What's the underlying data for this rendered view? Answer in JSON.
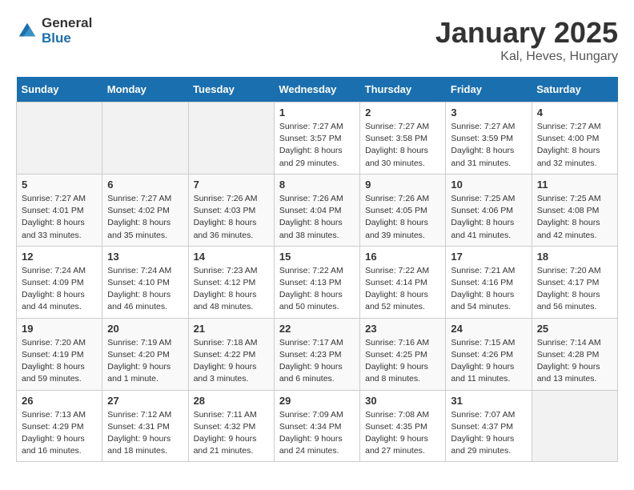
{
  "logo": {
    "text_general": "General",
    "text_blue": "Blue"
  },
  "title": "January 2025",
  "subtitle": "Kal, Heves, Hungary",
  "weekdays": [
    "Sunday",
    "Monday",
    "Tuesday",
    "Wednesday",
    "Thursday",
    "Friday",
    "Saturday"
  ],
  "weeks": [
    [
      {
        "day": "",
        "sunrise": "",
        "sunset": "",
        "daylight": "",
        "empty": true
      },
      {
        "day": "",
        "sunrise": "",
        "sunset": "",
        "daylight": "",
        "empty": true
      },
      {
        "day": "",
        "sunrise": "",
        "sunset": "",
        "daylight": "",
        "empty": true
      },
      {
        "day": "1",
        "sunrise": "Sunrise: 7:27 AM",
        "sunset": "Sunset: 3:57 PM",
        "daylight": "Daylight: 8 hours and 29 minutes."
      },
      {
        "day": "2",
        "sunrise": "Sunrise: 7:27 AM",
        "sunset": "Sunset: 3:58 PM",
        "daylight": "Daylight: 8 hours and 30 minutes."
      },
      {
        "day": "3",
        "sunrise": "Sunrise: 7:27 AM",
        "sunset": "Sunset: 3:59 PM",
        "daylight": "Daylight: 8 hours and 31 minutes."
      },
      {
        "day": "4",
        "sunrise": "Sunrise: 7:27 AM",
        "sunset": "Sunset: 4:00 PM",
        "daylight": "Daylight: 8 hours and 32 minutes."
      }
    ],
    [
      {
        "day": "5",
        "sunrise": "Sunrise: 7:27 AM",
        "sunset": "Sunset: 4:01 PM",
        "daylight": "Daylight: 8 hours and 33 minutes."
      },
      {
        "day": "6",
        "sunrise": "Sunrise: 7:27 AM",
        "sunset": "Sunset: 4:02 PM",
        "daylight": "Daylight: 8 hours and 35 minutes."
      },
      {
        "day": "7",
        "sunrise": "Sunrise: 7:26 AM",
        "sunset": "Sunset: 4:03 PM",
        "daylight": "Daylight: 8 hours and 36 minutes."
      },
      {
        "day": "8",
        "sunrise": "Sunrise: 7:26 AM",
        "sunset": "Sunset: 4:04 PM",
        "daylight": "Daylight: 8 hours and 38 minutes."
      },
      {
        "day": "9",
        "sunrise": "Sunrise: 7:26 AM",
        "sunset": "Sunset: 4:05 PM",
        "daylight": "Daylight: 8 hours and 39 minutes."
      },
      {
        "day": "10",
        "sunrise": "Sunrise: 7:25 AM",
        "sunset": "Sunset: 4:06 PM",
        "daylight": "Daylight: 8 hours and 41 minutes."
      },
      {
        "day": "11",
        "sunrise": "Sunrise: 7:25 AM",
        "sunset": "Sunset: 4:08 PM",
        "daylight": "Daylight: 8 hours and 42 minutes."
      }
    ],
    [
      {
        "day": "12",
        "sunrise": "Sunrise: 7:24 AM",
        "sunset": "Sunset: 4:09 PM",
        "daylight": "Daylight: 8 hours and 44 minutes."
      },
      {
        "day": "13",
        "sunrise": "Sunrise: 7:24 AM",
        "sunset": "Sunset: 4:10 PM",
        "daylight": "Daylight: 8 hours and 46 minutes."
      },
      {
        "day": "14",
        "sunrise": "Sunrise: 7:23 AM",
        "sunset": "Sunset: 4:12 PM",
        "daylight": "Daylight: 8 hours and 48 minutes."
      },
      {
        "day": "15",
        "sunrise": "Sunrise: 7:22 AM",
        "sunset": "Sunset: 4:13 PM",
        "daylight": "Daylight: 8 hours and 50 minutes."
      },
      {
        "day": "16",
        "sunrise": "Sunrise: 7:22 AM",
        "sunset": "Sunset: 4:14 PM",
        "daylight": "Daylight: 8 hours and 52 minutes."
      },
      {
        "day": "17",
        "sunrise": "Sunrise: 7:21 AM",
        "sunset": "Sunset: 4:16 PM",
        "daylight": "Daylight: 8 hours and 54 minutes."
      },
      {
        "day": "18",
        "sunrise": "Sunrise: 7:20 AM",
        "sunset": "Sunset: 4:17 PM",
        "daylight": "Daylight: 8 hours and 56 minutes."
      }
    ],
    [
      {
        "day": "19",
        "sunrise": "Sunrise: 7:20 AM",
        "sunset": "Sunset: 4:19 PM",
        "daylight": "Daylight: 8 hours and 59 minutes."
      },
      {
        "day": "20",
        "sunrise": "Sunrise: 7:19 AM",
        "sunset": "Sunset: 4:20 PM",
        "daylight": "Daylight: 9 hours and 1 minute."
      },
      {
        "day": "21",
        "sunrise": "Sunrise: 7:18 AM",
        "sunset": "Sunset: 4:22 PM",
        "daylight": "Daylight: 9 hours and 3 minutes."
      },
      {
        "day": "22",
        "sunrise": "Sunrise: 7:17 AM",
        "sunset": "Sunset: 4:23 PM",
        "daylight": "Daylight: 9 hours and 6 minutes."
      },
      {
        "day": "23",
        "sunrise": "Sunrise: 7:16 AM",
        "sunset": "Sunset: 4:25 PM",
        "daylight": "Daylight: 9 hours and 8 minutes."
      },
      {
        "day": "24",
        "sunrise": "Sunrise: 7:15 AM",
        "sunset": "Sunset: 4:26 PM",
        "daylight": "Daylight: 9 hours and 11 minutes."
      },
      {
        "day": "25",
        "sunrise": "Sunrise: 7:14 AM",
        "sunset": "Sunset: 4:28 PM",
        "daylight": "Daylight: 9 hours and 13 minutes."
      }
    ],
    [
      {
        "day": "26",
        "sunrise": "Sunrise: 7:13 AM",
        "sunset": "Sunset: 4:29 PM",
        "daylight": "Daylight: 9 hours and 16 minutes."
      },
      {
        "day": "27",
        "sunrise": "Sunrise: 7:12 AM",
        "sunset": "Sunset: 4:31 PM",
        "daylight": "Daylight: 9 hours and 18 minutes."
      },
      {
        "day": "28",
        "sunrise": "Sunrise: 7:11 AM",
        "sunset": "Sunset: 4:32 PM",
        "daylight": "Daylight: 9 hours and 21 minutes."
      },
      {
        "day": "29",
        "sunrise": "Sunrise: 7:09 AM",
        "sunset": "Sunset: 4:34 PM",
        "daylight": "Daylight: 9 hours and 24 minutes."
      },
      {
        "day": "30",
        "sunrise": "Sunrise: 7:08 AM",
        "sunset": "Sunset: 4:35 PM",
        "daylight": "Daylight: 9 hours and 27 minutes."
      },
      {
        "day": "31",
        "sunrise": "Sunrise: 7:07 AM",
        "sunset": "Sunset: 4:37 PM",
        "daylight": "Daylight: 9 hours and 29 minutes."
      },
      {
        "day": "",
        "sunrise": "",
        "sunset": "",
        "daylight": "",
        "empty": true
      }
    ]
  ]
}
